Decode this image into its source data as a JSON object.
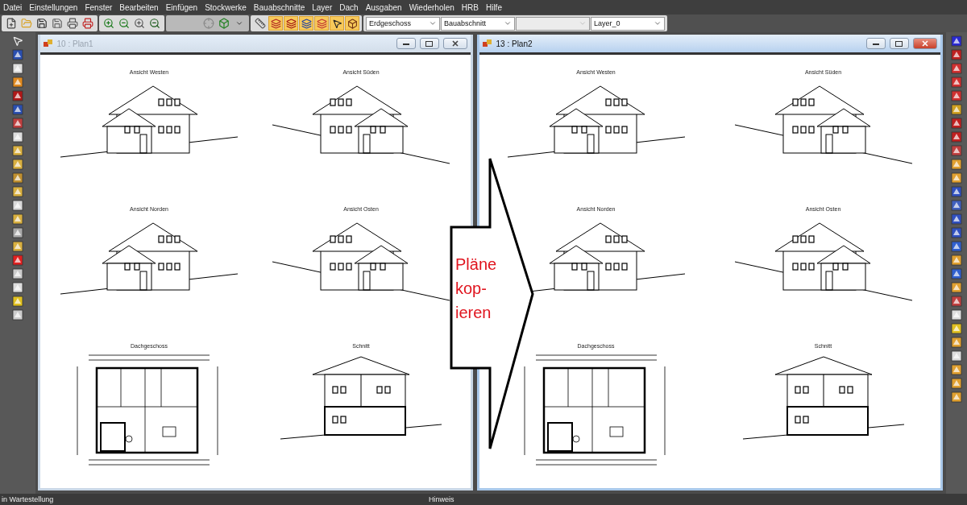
{
  "menu": [
    "Datei",
    "Einstellungen",
    "Fenster",
    "Bearbeiten",
    "Einfügen",
    "Stockwerke",
    "Bauabschnitte",
    "Layer",
    "Dach",
    "Ausgaben",
    "Wiederholen",
    "HRB",
    "Hilfe"
  ],
  "toolbar": {
    "dropdowns": [
      {
        "value": "Erdgeschoss",
        "disabled": false
      },
      {
        "value": "Bauabschnitt",
        "disabled": false
      },
      {
        "disabled": true
      },
      {
        "value": "Layer_0",
        "disabled": false
      }
    ]
  },
  "windows": [
    {
      "title": "10 : Plan1",
      "active": false,
      "sheets": [
        {
          "label": "Ansicht Westen",
          "kind": "elevation"
        },
        {
          "label": "Ansicht Süden",
          "kind": "elevation"
        },
        {
          "label": "Ansicht Norden",
          "kind": "elevation"
        },
        {
          "label": "Ansicht Osten",
          "kind": "elevation"
        },
        {
          "label": "Dachgeschoss",
          "kind": "floorplan"
        },
        {
          "label": "Schnitt",
          "kind": "section"
        }
      ]
    },
    {
      "title": "13 : Plan2",
      "active": true,
      "sheets": [
        {
          "label": "Ansicht Westen",
          "kind": "elevation"
        },
        {
          "label": "Ansicht Süden",
          "kind": "elevation"
        },
        {
          "label": "Ansicht Norden",
          "kind": "elevation"
        },
        {
          "label": "Ansicht Osten",
          "kind": "elevation"
        },
        {
          "label": "Dachgeschoss",
          "kind": "floorplan"
        },
        {
          "label": "Schnitt",
          "kind": "section"
        }
      ]
    }
  ],
  "callout": {
    "lines": [
      "Pläne",
      "kop-",
      "ieren"
    ]
  },
  "status_bar": [
    "in Wartestellung",
    "Hinweis"
  ]
}
